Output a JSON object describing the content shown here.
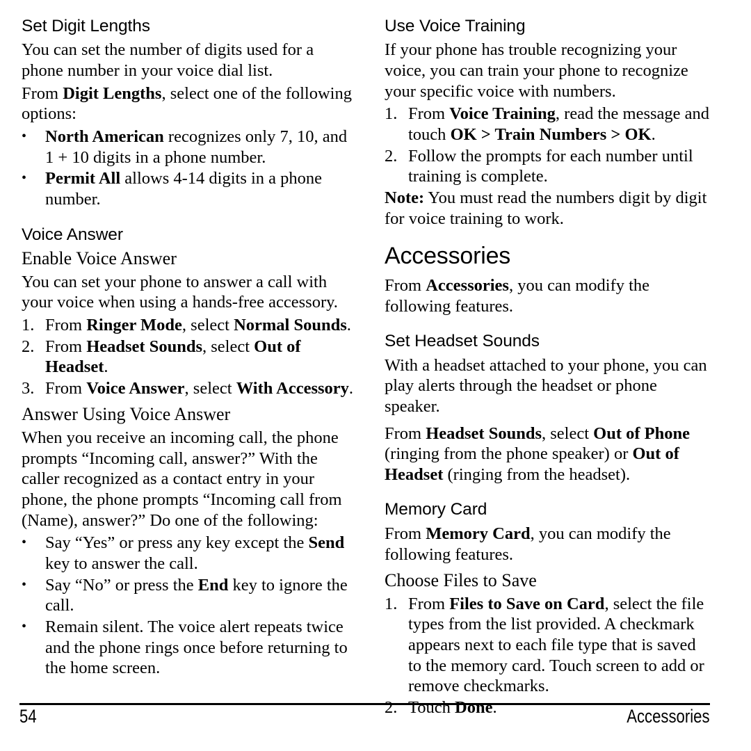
{
  "page": {
    "number": "54",
    "running_head": "Accessories"
  },
  "left_column": {
    "section_1": {
      "heading": "Set Digit Lengths",
      "paragraph_1": "You can set the number of digits used for a phone number in your voice dial list.",
      "paragraph_2_parts": [
        {
          "text": "From ",
          "bold": false
        },
        {
          "text": "Digit Lengths",
          "bold": true
        },
        {
          "text": ", select one of the following options:",
          "bold": false
        }
      ],
      "bullets": [
        {
          "marker": "•",
          "parts": [
            {
              "text": "North American",
              "bold": true
            },
            {
              "text": " recognizes only 7, 10, and 1 + 10 digits in a phone number.",
              "bold": false
            }
          ]
        },
        {
          "marker": "•",
          "parts": [
            {
              "text": "Permit All",
              "bold": true
            },
            {
              "text": " allows 4-14 digits in a phone number.",
              "bold": false
            }
          ]
        }
      ]
    },
    "section_2": {
      "heading": "Voice Answer",
      "subsection_1": {
        "heading": "Enable Voice Answer",
        "paragraph": "You can set your phone to answer a call with your voice when using a hands-free accessory.",
        "steps": [
          {
            "marker": "1.",
            "parts": [
              {
                "text": "From ",
                "bold": false
              },
              {
                "text": "Ringer Mode",
                "bold": true
              },
              {
                "text": ", select ",
                "bold": false
              },
              {
                "text": "Normal Sounds",
                "bold": true
              },
              {
                "text": ".",
                "bold": false
              }
            ]
          },
          {
            "marker": "2.",
            "parts": [
              {
                "text": "From ",
                "bold": false
              },
              {
                "text": "Headset Sounds",
                "bold": true
              },
              {
                "text": ", select ",
                "bold": false
              },
              {
                "text": "Out of Headset",
                "bold": true
              },
              {
                "text": ".",
                "bold": false
              }
            ]
          },
          {
            "marker": "3.",
            "parts": [
              {
                "text": "From ",
                "bold": false
              },
              {
                "text": "Voice Answer",
                "bold": true
              },
              {
                "text": ", select ",
                "bold": false
              },
              {
                "text": "With Accessory",
                "bold": true
              },
              {
                "text": ".",
                "bold": false
              }
            ]
          }
        ]
      },
      "subsection_2": {
        "heading": "Answer Using Voice Answer",
        "paragraph": "When you receive an incoming call, the phone prompts “Incoming call, answer?” With the caller recognized as a contact entry in your phone, the phone prompts “Incoming call from (Name), answer?” Do one of the following:",
        "bullets": [
          {
            "marker": "•",
            "parts": [
              {
                "text": "Say “Yes” or press any key except the ",
                "bold": false
              },
              {
                "text": "Send",
                "bold": true
              },
              {
                "text": " key to answer the call.",
                "bold": false
              }
            ]
          },
          {
            "marker": "•",
            "parts": [
              {
                "text": "Say “No” or press the ",
                "bold": false
              },
              {
                "text": "End",
                "bold": true
              },
              {
                "text": " key to ignore the call.",
                "bold": false
              }
            ]
          },
          {
            "marker": "•",
            "parts": [
              {
                "text": "Remain silent. The voice alert repeats twice and the phone rings once before returning to the home screen.",
                "bold": false
              }
            ]
          }
        ]
      }
    }
  },
  "right_column": {
    "section_1": {
      "heading": "Use Voice Training",
      "paragraph": "If your phone has trouble recognizing your voice, you can train your phone to recognize your specific voice with numbers.",
      "steps": [
        {
          "marker": "1.",
          "parts": [
            {
              "text": "From ",
              "bold": false
            },
            {
              "text": "Voice Training",
              "bold": true
            },
            {
              "text": ", read the message and touch ",
              "bold": false
            },
            {
              "text": "OK > Train Numbers > OK",
              "bold": true
            },
            {
              "text": ".",
              "bold": false
            }
          ]
        },
        {
          "marker": "2.",
          "parts": [
            {
              "text": "Follow the prompts for each number until training is complete.",
              "bold": false
            }
          ]
        }
      ],
      "note_parts": [
        {
          "text": "Note:",
          "bold": true
        },
        {
          "text": " You must read the numbers digit by digit for voice training to work.",
          "bold": false
        }
      ]
    },
    "chapter": {
      "title": "Accessories",
      "paragraph_parts": [
        {
          "text": "From ",
          "bold": false
        },
        {
          "text": "Accessories",
          "bold": true
        },
        {
          "text": ", you can modify the following features.",
          "bold": false
        }
      ]
    },
    "section_2": {
      "heading": "Set Headset Sounds",
      "paragraph": "With a headset attached to your phone, you can play alerts through the headset or phone speaker.",
      "paragraph_2_parts": [
        {
          "text": "From ",
          "bold": false
        },
        {
          "text": "Headset Sounds",
          "bold": true
        },
        {
          "text": ", select ",
          "bold": false
        },
        {
          "text": "Out of Phone",
          "bold": true
        },
        {
          "text": " (ringing from the phone speaker) or ",
          "bold": false
        },
        {
          "text": "Out of Headset",
          "bold": true
        },
        {
          "text": " (ringing from the headset).",
          "bold": false
        }
      ]
    },
    "section_3": {
      "heading": "Memory Card",
      "paragraph_parts": [
        {
          "text": "From ",
          "bold": false
        },
        {
          "text": "Memory Card",
          "bold": true
        },
        {
          "text": ", you can modify the following features.",
          "bold": false
        }
      ],
      "subsection": {
        "heading": "Choose Files to Save",
        "steps": [
          {
            "marker": "1.",
            "parts": [
              {
                "text": "From ",
                "bold": false
              },
              {
                "text": "Files to Save on Card",
                "bold": true
              },
              {
                "text": ", select the file types from the list provided. A checkmark appears next to each file type that is saved to the memory card. Touch screen to add or remove checkmarks.",
                "bold": false
              }
            ]
          },
          {
            "marker": "2.",
            "parts": [
              {
                "text": "Touch ",
                "bold": false
              },
              {
                "text": "Done",
                "bold": true
              },
              {
                "text": ".",
                "bold": false
              }
            ]
          }
        ]
      }
    }
  }
}
